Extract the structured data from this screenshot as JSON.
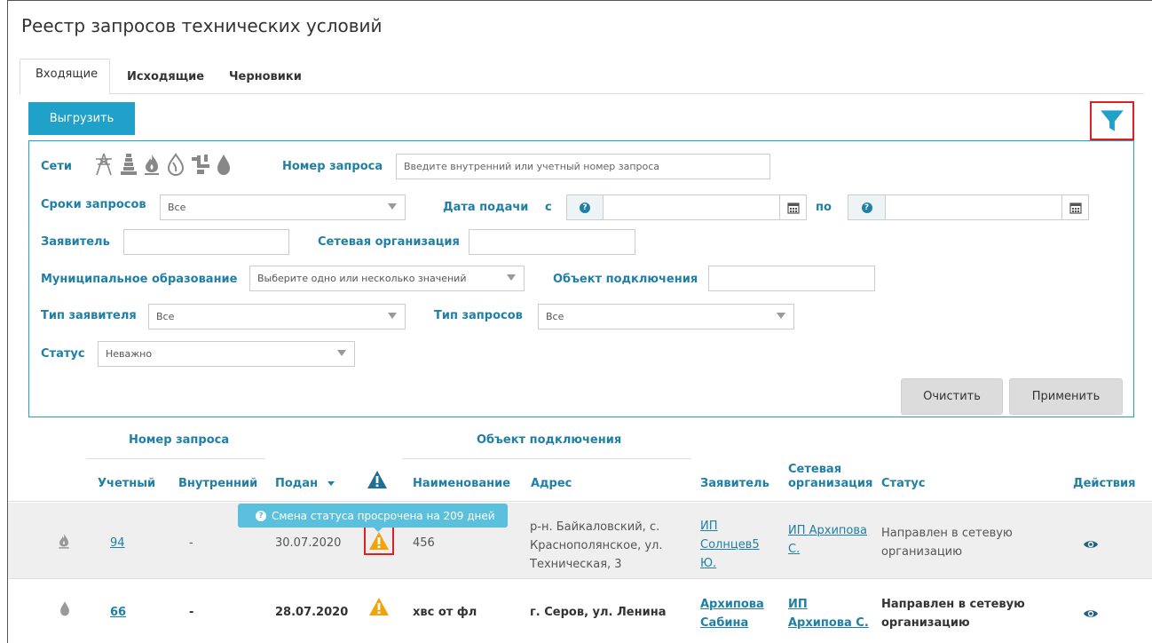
{
  "page_title": "Реестр запросов технических условий",
  "tabs": [
    {
      "label": "Входящие",
      "active": true
    },
    {
      "label": "Исходящие",
      "active": false
    },
    {
      "label": "Черновики",
      "active": false
    }
  ],
  "toolbar": {
    "export_label": "Выгрузить"
  },
  "filters": {
    "networks_label": "Сети",
    "network_icons": [
      "electricity-icon",
      "heating-icon",
      "gas-icon",
      "water-supply-icon",
      "sewerage-icon",
      "water-drop-icon"
    ],
    "request_number_label": "Номер запроса",
    "request_number_placeholder": "Введите внутренний или учетный номер запроса",
    "deadlines_label": "Сроки запросов",
    "deadlines_value": "Все",
    "submit_date_label": "Дата подачи",
    "from_label": "с",
    "to_label": "по",
    "help_glyph": "?",
    "applicant_label": "Заявитель",
    "applicant_value": "",
    "network_org_label": "Сетевая организация",
    "network_org_value": "",
    "municipality_label": "Муниципальное образование",
    "municipality_placeholder": "Выберите одно или несколько значений",
    "object_label": "Объект подключения",
    "object_value": "",
    "applicant_type_label": "Тип заявителя",
    "applicant_type_value": "Все",
    "request_type_label": "Тип запросов",
    "request_type_value": "Все",
    "status_label": "Статус",
    "status_value": "Неважно",
    "clear_label": "Очистить",
    "apply_label": "Применить"
  },
  "table": {
    "group_request_number": "Номер запроса",
    "group_object": "Объект подключения",
    "col_account": "Учетный",
    "col_internal": "Внутренний",
    "col_submitted": "Подан",
    "col_name": "Наименование",
    "col_address": "Адрес",
    "col_applicant": "Заявитель",
    "col_network_org_1": "Сетевая",
    "col_network_org_2": "организация",
    "col_status": "Статус",
    "col_actions": "Действия",
    "rows": [
      {
        "icon": "gas-icon",
        "account": "94",
        "internal": "-",
        "submitted": "30.07.2020",
        "name": "456",
        "address_lines": [
          "р-н. Байкаловский, с.",
          "Краснополянское, ул.",
          "Техническая, 3"
        ],
        "applicant_lines": [
          "ИП",
          "Солнцев5",
          "Ю."
        ],
        "network_org_lines": [
          "ИП Архипова",
          "С."
        ],
        "status_lines": [
          "Направлен в сетевую",
          "организацию"
        ]
      },
      {
        "icon": "water-drop-icon",
        "account": "66",
        "internal": "-",
        "submitted": "28.07.2020",
        "name": "хвс от фл",
        "address_lines": [
          "г. Серов, ул. Ленина"
        ],
        "applicant_lines": [
          "Архипова",
          "Сабина"
        ],
        "network_org_lines": [
          "ИП",
          "Архипова С."
        ],
        "status_lines": [
          "Направлен в сетевую",
          "организацию"
        ]
      }
    ]
  },
  "tooltip": {
    "text": "Смена статуса просрочена на 209 дней",
    "glyph": "?"
  },
  "colors": {
    "accent": "#1fa1c9",
    "label": "#1f7fa5",
    "warning": "#f0a30a",
    "highlight": "#e02020"
  }
}
